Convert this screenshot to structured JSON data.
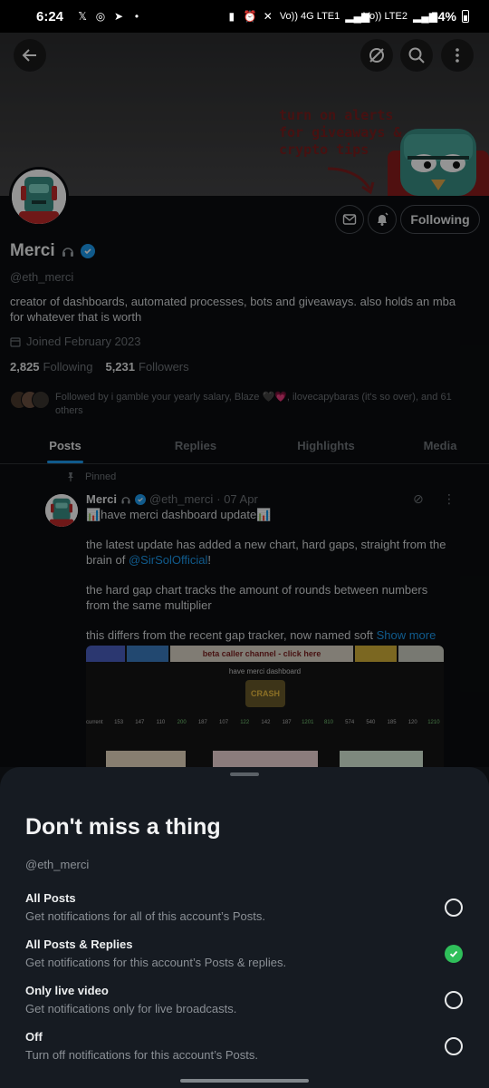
{
  "status_bar": {
    "time": "6:24",
    "battery": "54%",
    "net1": "Vo)) 4G LTE1",
    "net2": "Vo)) LTE2"
  },
  "banner": {
    "text_lines": [
      "turn on alerts",
      "for giveaways &",
      "crypto tips"
    ]
  },
  "profile": {
    "name": "Merci",
    "handle": "@eth_merci",
    "bio": "creator of dashboards, automated processes, bots and giveaways. also holds an mba for whatever that is worth",
    "joined": "Joined February 2023",
    "following_count": "2,825",
    "following_label": "Following",
    "followers_count": "5,231",
    "followers_label": "Followers",
    "followed_by": "Followed by i gamble your yearly salary, Blaze 🖤💗, ilovecapybaras (it's so over), and 61 others",
    "follow_button": "Following"
  },
  "tabs": [
    {
      "label": "Posts",
      "active": true
    },
    {
      "label": "Replies",
      "active": false
    },
    {
      "label": "Highlights",
      "active": false
    },
    {
      "label": "Media",
      "active": false
    }
  ],
  "post": {
    "pinned_label": "Pinned",
    "author": "Merci",
    "handle": "@eth_merci",
    "time": "· 07 Apr",
    "line1": "📊have merci dashboard update📊",
    "p2a": "the latest update has added a new chart, hard gaps, straight from the brain of ",
    "p2_link": "@SirSolOfficial",
    "p2b": "!",
    "p3": "the hard gap chart tracks the amount of rounds between numbers from the same multiplier",
    "p4": "this differs from the recent gap tracker, now named soft ",
    "show_more": "Show more",
    "image": {
      "banner_text": "beta caller channel - click here",
      "title": "have merci dashboard",
      "logo_text": "CRASH",
      "row_label": "current",
      "row_values": [
        "153",
        "147",
        "110",
        "200",
        "187",
        "107",
        "122",
        "142",
        "187",
        "1201",
        "810",
        "574",
        "540",
        "185",
        "120",
        "1210"
      ]
    }
  },
  "sheet": {
    "title": "Don't miss a thing",
    "handle": "@eth_merci",
    "options": [
      {
        "title": "All Posts",
        "desc": "Get notifications for all of this account’s Posts.",
        "selected": false
      },
      {
        "title": "All Posts & Replies",
        "desc": "Get notifications for this account’s Posts & replies.",
        "selected": true
      },
      {
        "title": "Only live video",
        "desc": "Get notifications only for live broadcasts.",
        "selected": false
      },
      {
        "title": "Off",
        "desc": "Turn off notifications for this account’s Posts.",
        "selected": false
      }
    ]
  },
  "colors": {
    "accent": "#1d9bf0",
    "selected": "#2fbf5a",
    "sheet_bg": "#161b22"
  }
}
